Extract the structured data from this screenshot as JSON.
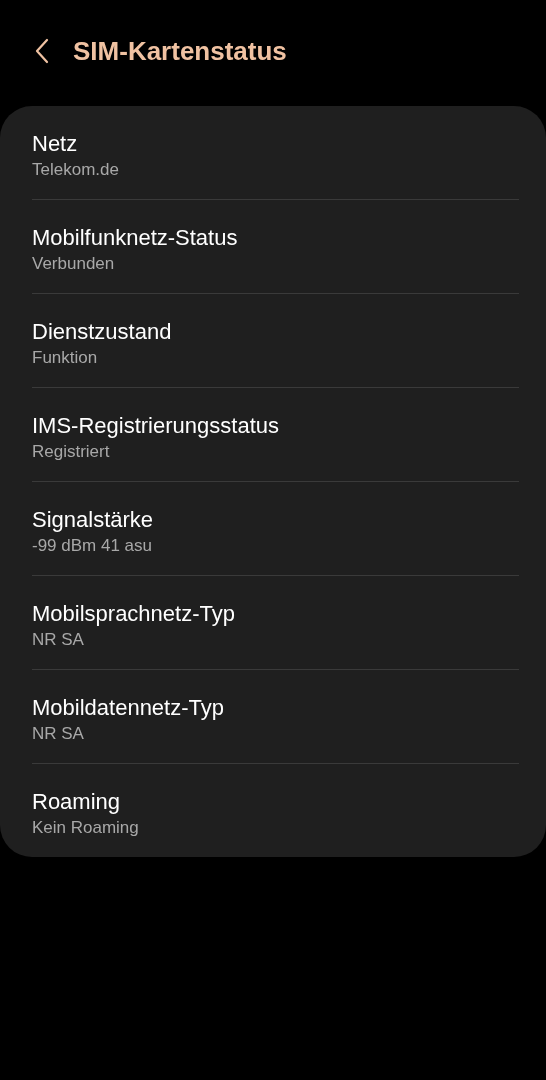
{
  "header": {
    "title": "SIM-Kartenstatus"
  },
  "items": [
    {
      "title": "Netz",
      "value": "Telekom.de"
    },
    {
      "title": "Mobilfunknetz-Status",
      "value": "Verbunden"
    },
    {
      "title": "Dienstzustand",
      "value": "Funktion"
    },
    {
      "title": "IMS-Registrierungsstatus",
      "value": "Registriert"
    },
    {
      "title": "Signalstärke",
      "value": "-99 dBm 41 asu"
    },
    {
      "title": "Mobilsprachnetz-Typ",
      "value": "NR SA"
    },
    {
      "title": "Mobildatennetz-Typ",
      "value": "NR SA"
    },
    {
      "title": "Roaming",
      "value": "Kein Roaming"
    }
  ]
}
